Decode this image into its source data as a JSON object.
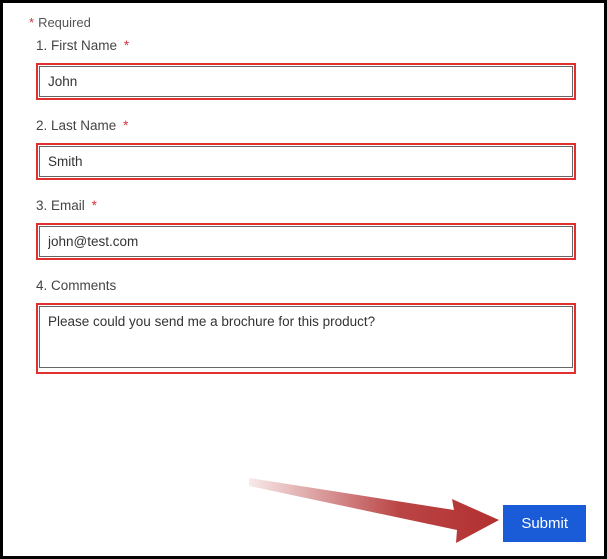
{
  "required_note": {
    "star": "*",
    "label": "Required"
  },
  "fields": {
    "first_name": {
      "number": "1.",
      "label": "First Name",
      "required": true,
      "value": "John"
    },
    "last_name": {
      "number": "2.",
      "label": "Last Name",
      "required": true,
      "value": "Smith"
    },
    "email": {
      "number": "3.",
      "label": "Email",
      "required": true,
      "value": "john@test.com"
    },
    "comments": {
      "number": "4.",
      "label": "Comments",
      "required": false,
      "value": "Please could you send me a brochure for this product?"
    }
  },
  "submit_label": "Submit"
}
